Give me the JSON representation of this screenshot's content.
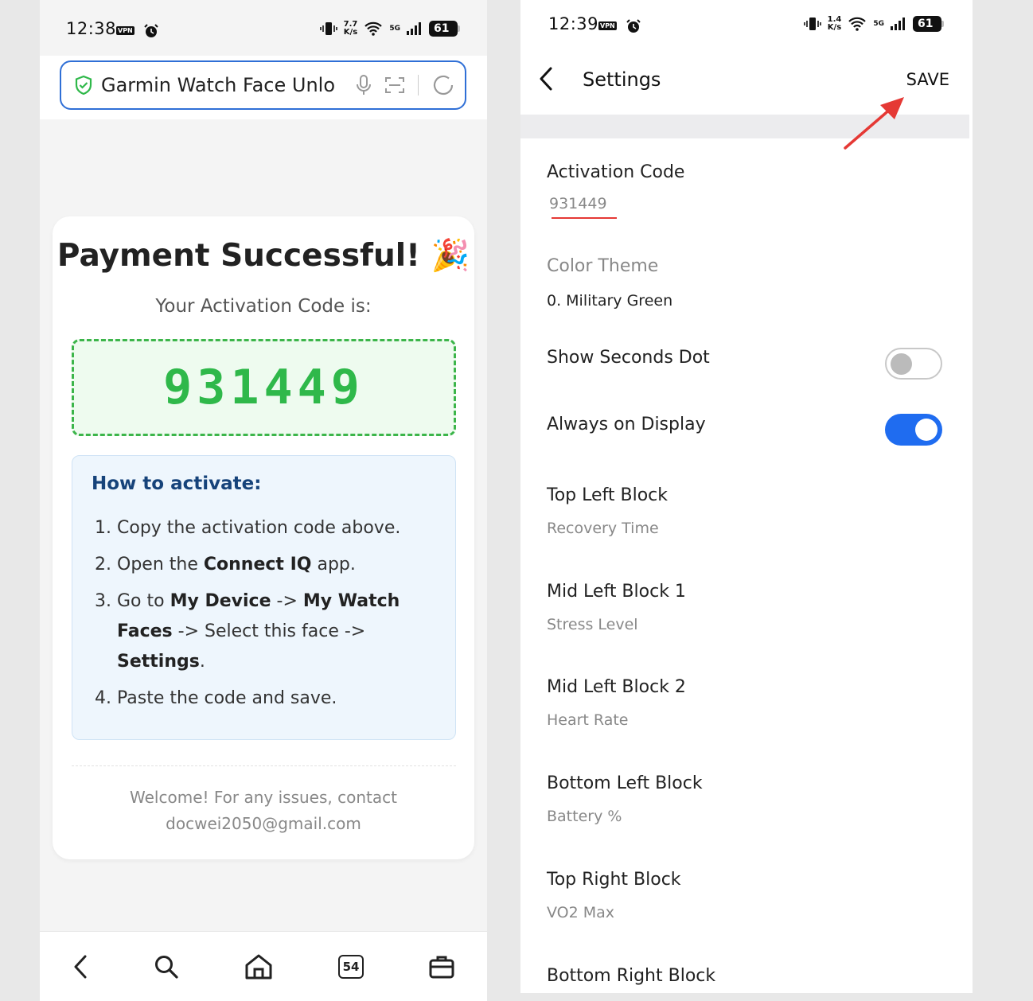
{
  "left": {
    "status": {
      "time": "12:38",
      "vpn": "VPN",
      "speed_top": "7.7",
      "speed_bottom": "K/s",
      "signal": "5G",
      "battery": "61"
    },
    "url_bar": {
      "text": "Garmin Watch Face Unlo"
    },
    "card": {
      "title": "Payment Successful! 🎉",
      "subtitle": "Your Activation Code is:",
      "code": "931449",
      "howto_heading": "How to activate:",
      "steps": {
        "s1": "Copy the activation code above.",
        "s2_a": "Open the ",
        "s2_b": "Connect IQ",
        "s2_c": " app.",
        "s3_a": "Go to ",
        "s3_b": "My Device",
        "s3_c": " -> ",
        "s3_d": "My Watch Faces",
        "s3_e": " -> Select this face -> ",
        "s3_f": "Settings",
        "s3_g": ".",
        "s4": "Paste the code and save."
      },
      "footer_line1": "Welcome! For any issues, contact",
      "footer_line2": "docwei2050@gmail.com"
    },
    "nav": {
      "tab_count": "54"
    }
  },
  "right": {
    "status": {
      "time": "12:39",
      "vpn": "VPN",
      "speed_top": "1.4",
      "speed_bottom": "K/s",
      "signal": "5G",
      "battery": "61"
    },
    "header": {
      "title": "Settings",
      "save": "SAVE"
    },
    "settings": {
      "activation": {
        "label": "Activation Code",
        "value": "931449"
      },
      "color_theme": {
        "label": "Color Theme",
        "value": "0. Military Green"
      },
      "seconds_dot": {
        "label": "Show Seconds Dot",
        "on": false
      },
      "aod": {
        "label": "Always on Display",
        "on": true
      },
      "top_left": {
        "label": "Top Left Block",
        "value": "Recovery Time"
      },
      "mid_left_1": {
        "label": "Mid Left Block 1",
        "value": "Stress Level"
      },
      "mid_left_2": {
        "label": "Mid Left Block 2",
        "value": "Heart Rate"
      },
      "bottom_left": {
        "label": "Bottom Left Block",
        "value": "Battery %"
      },
      "top_right": {
        "label": "Top Right Block",
        "value": "VO2 Max"
      },
      "bottom_right": {
        "label": "Bottom Right Block"
      }
    }
  },
  "colors": {
    "accent_blue": "#1f6cf0",
    "success_green": "#2fb84a",
    "arrow_red": "#e53935",
    "heading_navy": "#16437a"
  }
}
